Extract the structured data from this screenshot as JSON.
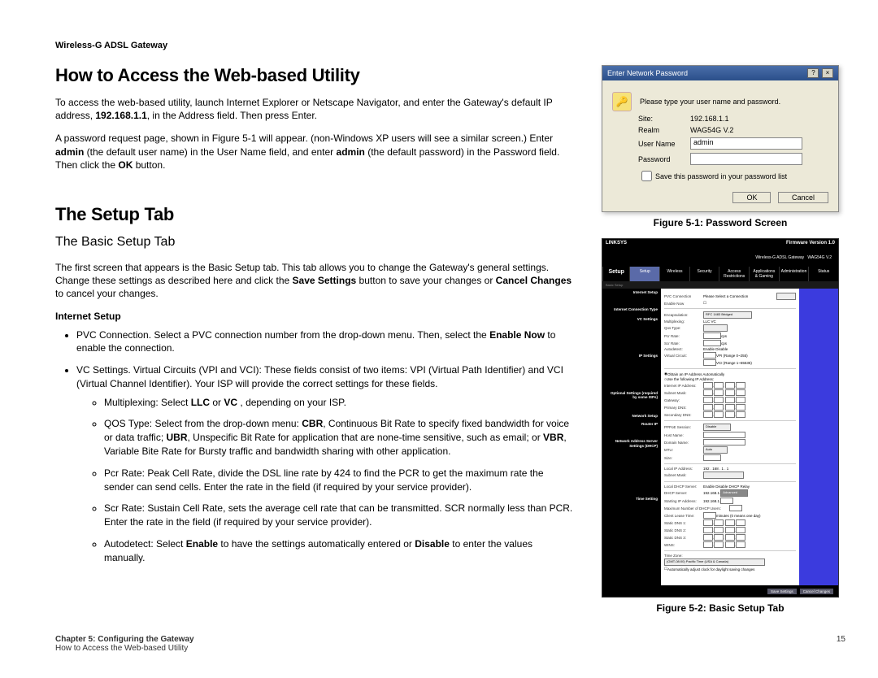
{
  "doc_header": "Wireless-G ADSL Gateway",
  "h1_access": "How to Access the Web-based Utility",
  "p_access_1a": "To access the web-based utility, launch Internet Explorer or Netscape Navigator, and enter the Gateway's default IP address, ",
  "p_access_1b": "192.168.1.1",
  "p_access_1c": ", in the Address field. Then press Enter.",
  "p_access_2a": "A password request page, shown in Figure 5-1 will appear. (non-Windows XP users will see a similar screen.) Enter ",
  "p_access_2b": "admin",
  "p_access_2c": " (the default user name) in the User Name field, and enter ",
  "p_access_2d": "admin",
  "p_access_2e": " (the default password) in the Password field.  Then click the ",
  "p_access_2f": "OK",
  "p_access_2g": " button.",
  "h1_setup": "The Setup Tab",
  "h2_basic": "The Basic Setup Tab",
  "p_basic_a": "The first screen that appears is the Basic Setup tab. This tab allows you to change the Gateway's general settings. Change these settings as described here and click the ",
  "p_basic_b": "Save Settings",
  "p_basic_c": " button to save your changes or ",
  "p_basic_d": "Cancel Changes",
  "p_basic_e": " to cancel your changes.",
  "h3_internet": "Internet Setup",
  "li_pvc_a": "PVC Connection. Select a PVC connection number from the drop-down menu. Then, select the ",
  "li_pvc_b": "Enable Now",
  "li_pvc_c": " to enable the connection.",
  "li_vc": "VC Settings. Virtual Circuits (VPI and VCI): These fields consist of two items: VPI (Virtual Path Identifier) and VCI (Virtual Channel Identifier). Your ISP will provide the correct settings for these fields.",
  "li_mux_a": "Multiplexing: Select ",
  "li_mux_b": "LLC",
  "li_mux_c": " or ",
  "li_mux_d": "VC",
  "li_mux_e": " , depending on your ISP.",
  "li_qos_a": "QOS Type: Select from the drop-down menu: ",
  "li_qos_b": "CBR",
  "li_qos_c": ", Continuous Bit Rate to specify fixed bandwidth for voice or data traffic; ",
  "li_qos_d": "UBR",
  "li_qos_e": ", Unspecific Bit Rate for application that are none-time sensitive, such as email; or ",
  "li_qos_f": "VBR",
  "li_qos_g": ", Variable Bite Rate for Bursty traffic and bandwidth sharing with other application.",
  "li_pcr": "Pcr Rate: Peak Cell Rate, divide the DSL line rate by 424 to find the PCR to get the maximum rate the sender can send cells. Enter the rate in the field (if required by your service provider).",
  "li_scr": "Scr Rate: Sustain Cell Rate, sets the average cell rate that can be transmitted. SCR normally less than PCR. Enter the rate in the field (if required by your service provider).",
  "li_auto_a": "Autodetect: Select ",
  "li_auto_b": "Enable",
  "li_auto_c": " to have the settings automatically entered or ",
  "li_auto_d": "Disable",
  "li_auto_e": " to enter the values manually.",
  "fig1_caption": "Figure 5-1: Password Screen",
  "fig2_caption": "Figure 5-2: Basic Setup Tab",
  "footer_chapter": "Chapter 5: Configuring the Gateway",
  "footer_sub": "How to Access the Web-based Utility",
  "footer_page": "15",
  "pw": {
    "title": "Enter Network Password",
    "q": "?",
    "x": "×",
    "prompt": "Please type your user name and password.",
    "site_lbl": "Site:",
    "site_val": "192.168.1.1",
    "realm_lbl": "Realm",
    "realm_val": "WAG54G V.2",
    "user_lbl": "User Name",
    "user_val": "admin",
    "pass_lbl": "Password",
    "save_lbl": "Save this password in your password list",
    "ok": "OK",
    "cancel": "Cancel"
  },
  "setup": {
    "brand": "LINKSYS",
    "fw": "Firmware Version 1.0",
    "product": "Wireless-G ADSL Gateway",
    "model": "WAG54G V.2",
    "tab_setup": "Setup",
    "tabs": [
      "Setup",
      "Wireless",
      "Security",
      "Access Restrictions",
      "Applications & Gaming",
      "Administration",
      "Status"
    ],
    "subtabs": "Basic Setup",
    "left_groups": [
      "Internet Setup",
      "Internet Connection Type",
      "VC Settings",
      "IP Settings",
      "Optional Settings (required by some ISPs)",
      "Network Setup",
      "Router IP",
      "Network Address Server Settings (DHCP)",
      "Time Setting"
    ],
    "panel": {
      "pvc_lbl": "PVC Connection",
      "pvc_val": "Please Select a Connection",
      "enable_lbl": "Enable Now",
      "encap_lbl": "Encapsulation:",
      "encap_val": "RFC 1483 Bridged",
      "mux_lbl": "Multiplexing:",
      "mux_val": "LLC   VC",
      "qos_lbl": "Qos Type:",
      "pcr_lbl": "Pcr Rate:",
      "pcr_unit": "cps",
      "scr_lbl": "Scr Rate:",
      "scr_unit": "cps",
      "auto_lbl": "Autodetect:",
      "auto_val": "Enable   Disable",
      "vpi_lbl": "Virtual Circuit:",
      "vpi_val": "VPI (Range 0~255)",
      "vci_val": "VCI (Range 1~65535)",
      "ip_opt1": "Obtain an IP Address Automatically",
      "ip_opt2": "Use the following IP Address:",
      "ip_lbl": "Internet IP Address:",
      "mask_lbl": "Subnet Mask:",
      "gw_lbl": "Gateway:",
      "dns1_lbl": "Primary DNS:",
      "dns2_lbl": "Secondary DNS:",
      "pppoe_lbl": "PPPoE Session:",
      "pppoe_val": "Disable",
      "host_lbl": "Host Name:",
      "dom_lbl": "Domain Name:",
      "mtu_lbl": "MTU:",
      "mtu_val": "Auto",
      "size_lbl": "Size:",
      "lip_lbl": "Local IP Address:",
      "lip_val": "192 . 168 . 1 . 1",
      "lmask_lbl": "Subnet Mask:",
      "dhcp_lbl": "Local DHCP Server:",
      "dhcp_val": "Enable   Disable   DHCP Relay",
      "dhcpsrv_lbl": "DHCP Server:",
      "adv_btn": "Advanced",
      "start_lbl": "Starting IP Address:",
      "start_val": "192.168.1.",
      "max_lbl": "Maximum Number of DHCP Users:",
      "lease_lbl": "Client Lease Time:",
      "lease_unit": "minutes (0 means one day)",
      "sdns1_lbl": "Static DNS 1:",
      "sdns2_lbl": "Static DNS 2:",
      "sdns3_lbl": "Static DNS 3:",
      "wins_lbl": "WINS:",
      "tz_lbl": "Time Zone:",
      "tz_val": "(GMT-08:00) Pacific Time (USA & Canada)",
      "dst_lbl": "Automatically adjust clock for daylight saving changes",
      "save": "Save Settings",
      "cancel": "Cancel Changes"
    }
  }
}
